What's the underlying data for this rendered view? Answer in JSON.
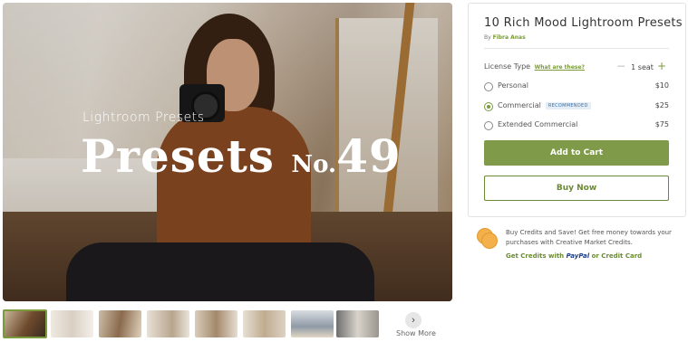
{
  "hero": {
    "overlay_subtitle": "Lightroom Presets",
    "overlay_title": "Presets",
    "overlay_no": "No.",
    "overlay_number": "49"
  },
  "thumbnails": {
    "count": 8,
    "selected_index": 0,
    "more_icon": "chevron-right-icon",
    "more_label": "Show More"
  },
  "product": {
    "title": "10 Rich Mood Lightroom Presets",
    "by_label": "By",
    "author": "Fibra Anas",
    "license_label": "License Type",
    "license_help": "What are these?",
    "seat_label": "1 seat",
    "options": [
      {
        "label": "Personal",
        "price": "$10",
        "selected": false
      },
      {
        "label": "Commercial",
        "price": "$25",
        "selected": true,
        "badge": "RECOMMENDED"
      },
      {
        "label": "Extended Commercial",
        "price": "$75",
        "selected": false
      }
    ],
    "add_to_cart": "Add to Cart",
    "buy_now": "Buy Now",
    "accent": "#7f9b4a"
  },
  "credits": {
    "text": "Buy Credits and Save! Get free money towards your purchases with Creative Market Credits.",
    "link_prefix": "Get Credits with",
    "paypal": "PayPal",
    "link_suffix": "or Credit Card"
  }
}
